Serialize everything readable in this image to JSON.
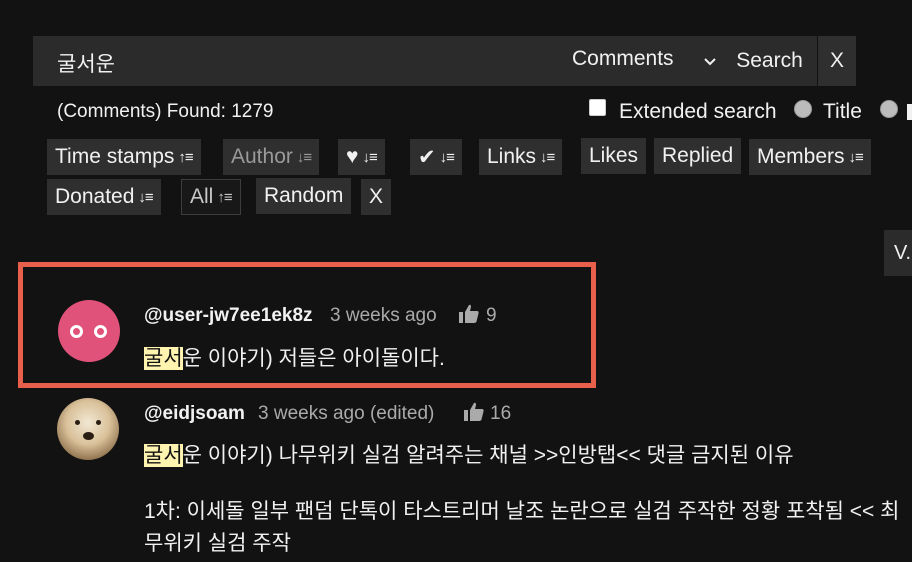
{
  "search": {
    "query": "굴서운",
    "scope": "Comments",
    "search_label": "Search",
    "clear_label": "X"
  },
  "results": {
    "found_text": "(Comments) Found: 1279"
  },
  "options": {
    "extended_search": "Extended search",
    "title": "Title"
  },
  "filters": {
    "time_stamps": "Time stamps",
    "author": "Author",
    "likes_sort_icon": "heart",
    "check_sort_icon": "check",
    "links": "Links",
    "likes": "Likes",
    "replied": "Replied",
    "members": "Members",
    "donated": "Donated",
    "all": "All",
    "random": "Random",
    "clear": "X"
  },
  "side_button": "V.",
  "colors": {
    "background": "#121212",
    "highlight_border": "#e8604c",
    "match_highlight": "#fff3b0",
    "avatar1": "#e0527a"
  },
  "comments": [
    {
      "author": "@user-jw7ee1ek8z",
      "time": "3 weeks ago",
      "likes": "9",
      "match": "굴서",
      "text_rest": "운 이야기) 저들은 아이돌이다."
    },
    {
      "author": "@eidjsoam",
      "time": "3 weeks ago (edited)",
      "likes": "16",
      "match": "굴서",
      "text_rest": "운 이야기) 나무위키 실검 알려주는 채널  >>인방탭<< 댓글 금지된 이유",
      "line2": "1차: 이세돌 일부 팬덤 단톡이 타스트리머 날조 논란으로 실검 주작한 정황 포착됨 << 최",
      "line3": "무위키 실검 주작"
    }
  ]
}
